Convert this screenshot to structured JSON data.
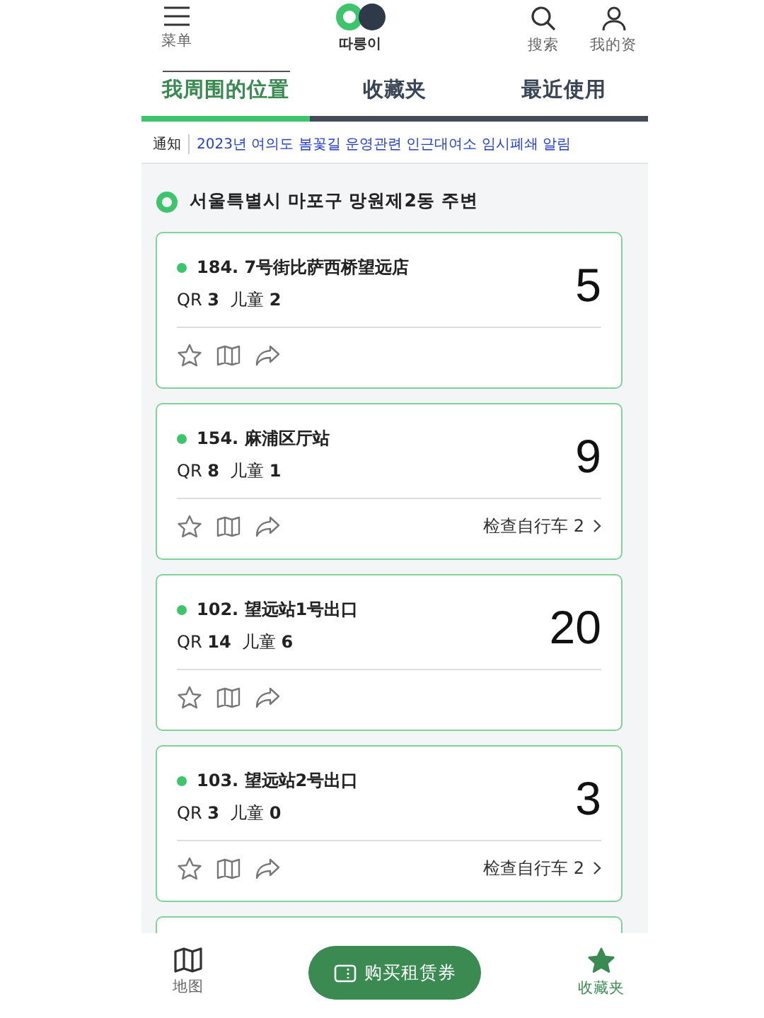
{
  "header": {
    "menu_label": "菜单",
    "logo_text": "따릉이",
    "search_label": "搜索",
    "profile_label": "我的资"
  },
  "tabs": [
    {
      "label": "我周围的位置",
      "selected": true
    },
    {
      "label": "收藏夹",
      "selected": false
    },
    {
      "label": "最近使用",
      "selected": false
    }
  ],
  "notice": {
    "tag": "通知",
    "text": "2023년 여의도 봄꽃길 운영관련 인근대여소 임시폐쇄 알림"
  },
  "location": "서울특별시 마포구 망원제2동 주변",
  "stations": [
    {
      "name": "184. 7号街比萨西桥望远店",
      "qr_label": "QR",
      "qr": "3",
      "kids_label": "儿童",
      "kids": "2",
      "count": "5"
    },
    {
      "name": "154. 麻浦区厅站",
      "qr_label": "QR",
      "qr": "8",
      "kids_label": "儿童",
      "kids": "1",
      "count": "9",
      "check_link": "检查自行车 2"
    },
    {
      "name": "102. 望远站1号出口",
      "qr_label": "QR",
      "qr": "14",
      "kids_label": "儿童",
      "kids": "6",
      "count": "20"
    },
    {
      "name": "103. 望远站2号出口",
      "qr_label": "QR",
      "qr": "3",
      "kids_label": "儿童",
      "kids": "0",
      "count": "3",
      "check_link": "检查自行车 2"
    }
  ],
  "bottom_nav": {
    "items": [
      {
        "kind": "map",
        "label": "地图",
        "selected": false
      },
      {
        "kind": "star",
        "label": "收藏夹",
        "selected": true
      }
    ],
    "buy_button": "购买租赁券"
  }
}
